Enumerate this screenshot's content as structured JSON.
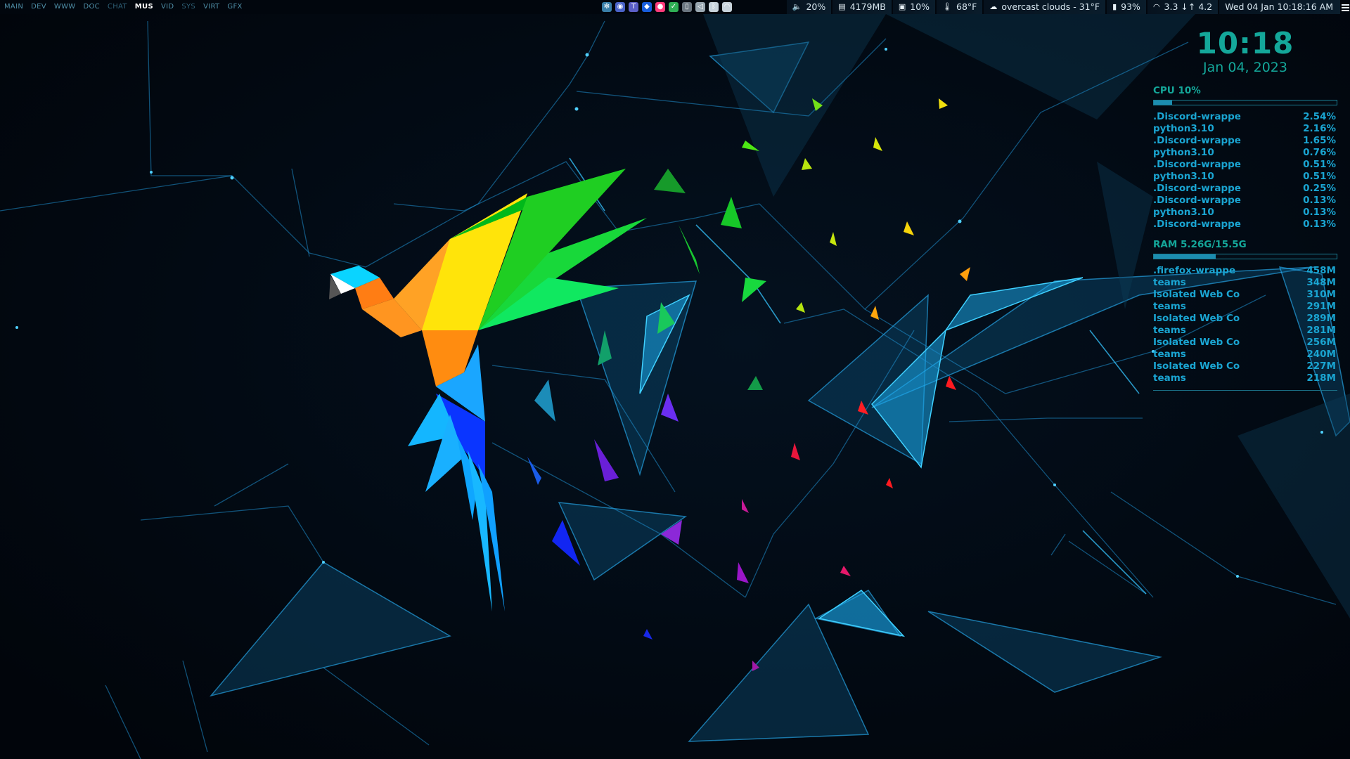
{
  "workspaces": [
    {
      "label": "MAIN",
      "state": "normal"
    },
    {
      "label": "DEV",
      "state": "normal"
    },
    {
      "label": "WWW",
      "state": "normal"
    },
    {
      "label": "DOC",
      "state": "normal"
    },
    {
      "label": "CHAT",
      "state": "dim"
    },
    {
      "label": "MUS",
      "state": "active"
    },
    {
      "label": "VID",
      "state": "normal"
    },
    {
      "label": "SYS",
      "state": "dim"
    },
    {
      "label": "VIRT",
      "state": "normal"
    },
    {
      "label": "GFX",
      "state": "normal"
    }
  ],
  "tray_icons": [
    {
      "name": "slack-icon",
      "color": "#3a7fa8"
    },
    {
      "name": "discord-icon",
      "color": "#4a63c8"
    },
    {
      "name": "teams-icon",
      "color": "#5b5fc7"
    },
    {
      "name": "bitwarden-icon",
      "color": "#175ddc"
    },
    {
      "name": "firefox-icon",
      "color": "#ff3b7b"
    },
    {
      "name": "checkmark-icon",
      "color": "#2faf55"
    },
    {
      "name": "clipboard-icon",
      "color": "#6b7680"
    },
    {
      "name": "speaker-icon",
      "color": "#9aa8b2"
    },
    {
      "name": "bluetooth-icon",
      "color": "#c8d4dc"
    },
    {
      "name": "wifi-icon",
      "color": "#c8d4dc"
    }
  ],
  "status": {
    "volume": "20%",
    "memory": "4179MB",
    "cpu": "10%",
    "temperature": "68°F",
    "weather": "overcast clouds - 31°F",
    "battery": "93%",
    "network": "3.3 ↓↑ 4.2",
    "datetime": "Wed 04 Jan 10:18:16 AM"
  },
  "conky": {
    "time": "10:18",
    "date": "Jan 04, 2023",
    "cpu_title": "CPU 10%",
    "cpu_fraction": 0.1,
    "cpu_processes": [
      {
        "name": ".Discord-wrappe",
        "value": "2.54%"
      },
      {
        "name": "python3.10",
        "value": "2.16%"
      },
      {
        "name": ".Discord-wrappe",
        "value": "1.65%"
      },
      {
        "name": "python3.10",
        "value": "0.76%"
      },
      {
        "name": ".Discord-wrappe",
        "value": "0.51%"
      },
      {
        "name": "python3.10",
        "value": "0.51%"
      },
      {
        "name": ".Discord-wrappe",
        "value": "0.25%"
      },
      {
        "name": ".Discord-wrappe",
        "value": "0.13%"
      },
      {
        "name": "python3.10",
        "value": "0.13%"
      },
      {
        "name": ".Discord-wrappe",
        "value": "0.13%"
      }
    ],
    "ram_title": "RAM 5.26G/15.5G",
    "ram_fraction": 0.34,
    "ram_processes": [
      {
        "name": ".firefox-wrappe",
        "value": "458M"
      },
      {
        "name": "teams",
        "value": "348M"
      },
      {
        "name": "Isolated Web Co",
        "value": "310M"
      },
      {
        "name": "teams",
        "value": "291M"
      },
      {
        "name": "Isolated Web Co",
        "value": "289M"
      },
      {
        "name": "teams",
        "value": "281M"
      },
      {
        "name": "Isolated Web Co",
        "value": "256M"
      },
      {
        "name": "teams",
        "value": "240M"
      },
      {
        "name": "Isolated Web Co",
        "value": "227M"
      },
      {
        "name": "teams",
        "value": "218M"
      }
    ]
  }
}
